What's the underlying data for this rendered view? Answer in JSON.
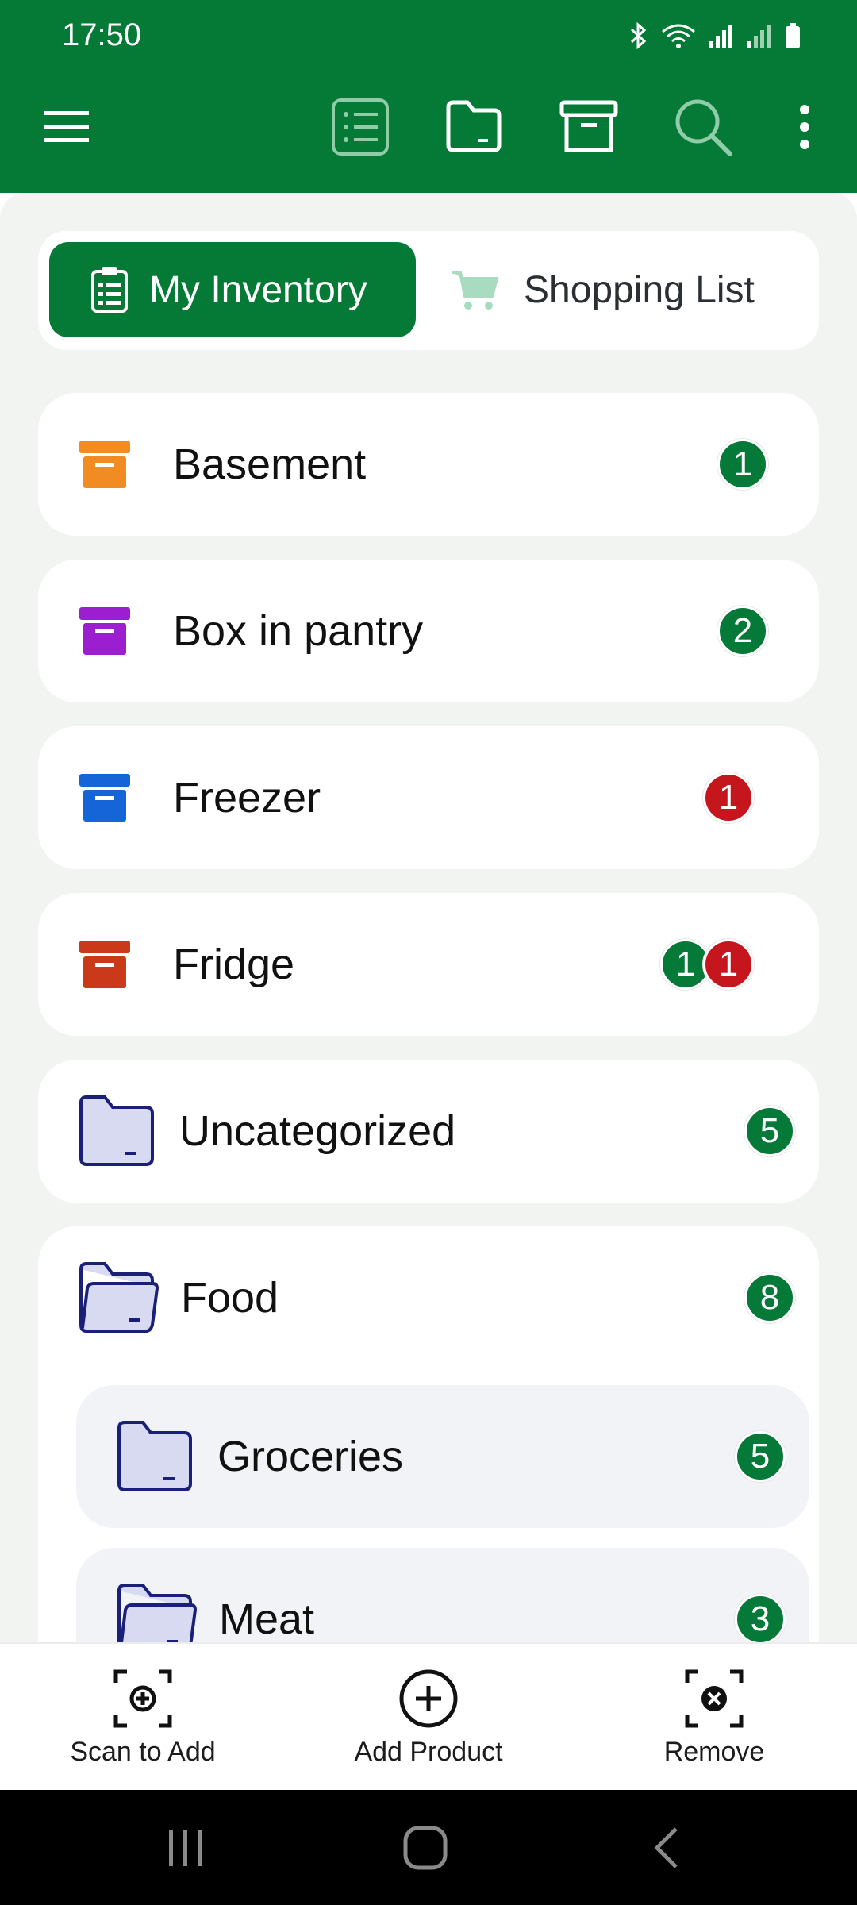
{
  "status_bar": {
    "time": "17:50",
    "icons": [
      "bluetooth-icon",
      "wifi-icon",
      "signal-icon",
      "signal-icon",
      "battery-icon"
    ]
  },
  "toolbar": {
    "icons": [
      "menu-icon",
      "list-icon",
      "folder-icon",
      "box-icon",
      "search-icon",
      "more-vert-icon"
    ]
  },
  "tabs": {
    "inventory_label": "My Inventory",
    "shopping_label": "Shopping List"
  },
  "locations": [
    {
      "name": "Basement",
      "color": "#f08c21",
      "badges": [
        {
          "value": "1",
          "color": "green"
        }
      ]
    },
    {
      "name": "Box in pantry",
      "color": "#9b1fd1",
      "badges": [
        {
          "value": "2",
          "color": "green"
        }
      ]
    },
    {
      "name": "Freezer",
      "color": "#1565d8",
      "badges": [
        {
          "value": "1",
          "color": "red"
        }
      ]
    },
    {
      "name": "Fridge",
      "color": "#c9391a",
      "badges": [
        {
          "value": "1",
          "color": "green"
        },
        {
          "value": "1",
          "color": "red"
        }
      ]
    }
  ],
  "categories": {
    "uncategorized": {
      "name": "Uncategorized",
      "count": "5"
    },
    "food": {
      "name": "Food",
      "count": "8"
    },
    "groceries": {
      "name": "Groceries",
      "count": "5"
    },
    "meat": {
      "name": "Meat",
      "count": "3"
    }
  },
  "bottom_actions": {
    "scan_label": "Scan to Add",
    "add_label": "Add Product",
    "remove_label": "Remove"
  },
  "colors": {
    "brand_green": "#047a36",
    "badge_green": "#057a38",
    "badge_red": "#c5151d",
    "folder_fill": "#d8daf2",
    "folder_stroke": "#1a1f78"
  }
}
